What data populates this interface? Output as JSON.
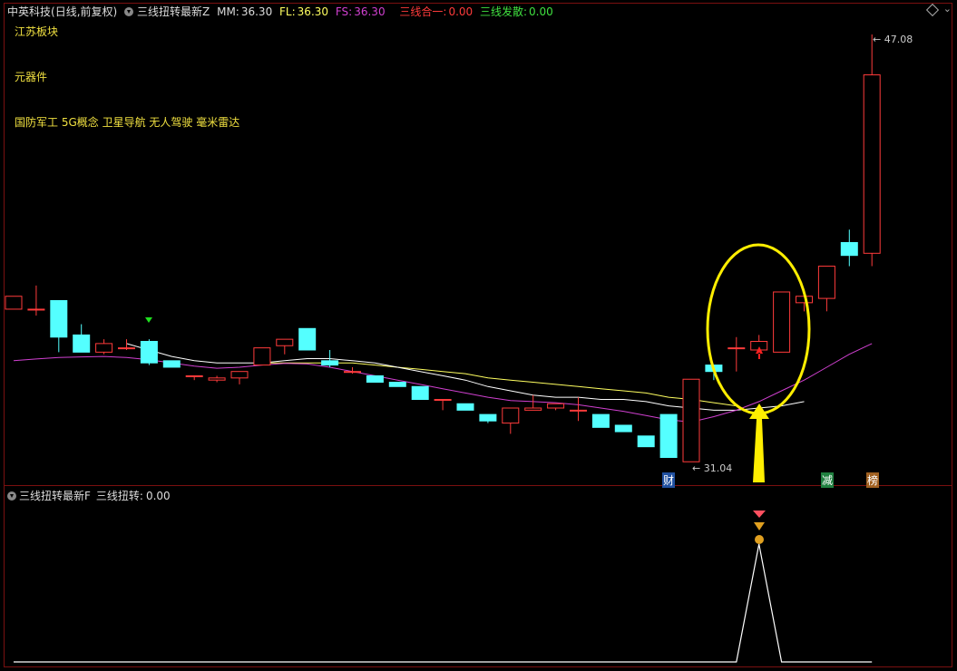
{
  "header": {
    "stock_name": "中英科技",
    "mode": "(日线,前复权)",
    "indicator": "三线扭转最新Z",
    "mm_label": "MM:",
    "mm_value": "36.30",
    "fl_label": "FL:",
    "fl_value": "36.30",
    "fs_label": "FS:",
    "fs_value": "36.30",
    "hy_label": "三线合一:",
    "hy_value": "0.00",
    "fs2_label": "三线发散:",
    "fs2_value": "0.00"
  },
  "labels": {
    "block1": "江苏板块",
    "block2": "元器件",
    "block3": "国防军工 5G概念 卫星导航 无人驾驶 毫米雷达"
  },
  "price_tags": {
    "high": "47.08",
    "low": "31.04"
  },
  "markers": {
    "cai": "财",
    "jian": "减",
    "bang": "榜"
  },
  "sub": {
    "indicator": "三线扭转最新F",
    "label": "三线扭转:",
    "value": "0.00"
  },
  "colors": {
    "up": "#ff3b3b",
    "down": "#54ffff",
    "ma1": "#ffff60",
    "ma2": "#ffffff",
    "ma3": "#d040d0",
    "highlight": "#ffee00"
  },
  "chart_data": {
    "type": "candlestick",
    "ohlc": [
      [
        34.3,
        34.9,
        34.3,
        34.9
      ],
      [
        34.3,
        34.3,
        35.4,
        34.0
      ],
      [
        34.7,
        33.0,
        34.7,
        32.3
      ],
      [
        33.1,
        32.3,
        33.6,
        32.3
      ],
      [
        32.3,
        32.7,
        32.9,
        32.2
      ],
      [
        32.5,
        32.5,
        32.9,
        32.4
      ],
      [
        32.8,
        31.8,
        32.9,
        31.7
      ],
      [
        31.9,
        31.6,
        31.9,
        31.6
      ],
      [
        31.2,
        31.2,
        31.2,
        31.0
      ],
      [
        31.0,
        31.1,
        31.2,
        30.9
      ],
      [
        31.1,
        31.4,
        31.4,
        30.8
      ],
      [
        31.7,
        32.5,
        32.5,
        31.7
      ],
      [
        32.6,
        32.9,
        32.9,
        32.2
      ],
      [
        33.4,
        32.4,
        33.4,
        32.4
      ],
      [
        31.9,
        31.7,
        32.4,
        31.6
      ],
      [
        31.4,
        31.4,
        31.6,
        31.3
      ],
      [
        31.2,
        30.9,
        31.2,
        30.9
      ],
      [
        30.9,
        30.7,
        30.9,
        30.7
      ],
      [
        30.7,
        30.1,
        30.7,
        30.1
      ],
      [
        30.1,
        30.1,
        30.1,
        29.6
      ],
      [
        29.9,
        29.6,
        29.9,
        29.6
      ],
      [
        29.4,
        29.1,
        29.4,
        29.0
      ],
      [
        29.0,
        29.7,
        29.7,
        28.5
      ],
      [
        29.6,
        29.7,
        30.3,
        29.6
      ],
      [
        29.7,
        29.9,
        29.9,
        29.6
      ],
      [
        29.6,
        29.6,
        30.2,
        29.1
      ],
      [
        29.4,
        28.8,
        29.4,
        28.8
      ],
      [
        28.9,
        28.6,
        28.9,
        28.6
      ],
      [
        28.4,
        27.9,
        28.4,
        27.9
      ],
      [
        29.4,
        27.4,
        29.4,
        27.4
      ],
      [
        27.2,
        31.04,
        31.04,
        27.2
      ],
      [
        31.7,
        31.4,
        31.7,
        31.0
      ],
      [
        32.5,
        32.5,
        33.0,
        31.4
      ],
      [
        32.4,
        32.8,
        33.1,
        32.3
      ],
      [
        32.3,
        35.1,
        35.1,
        32.3
      ],
      [
        34.6,
        34.9,
        34.9,
        34.2
      ],
      [
        34.8,
        36.3,
        36.3,
        34.2
      ],
      [
        37.4,
        36.8,
        38.0,
        36.3
      ],
      [
        36.9,
        45.2,
        47.08,
        36.3
      ]
    ],
    "ma_fast": [
      null,
      null,
      null,
      null,
      null,
      32.7,
      32.4,
      32.1,
      31.9,
      31.8,
      31.8,
      31.8,
      31.9,
      32.0,
      32.0,
      31.9,
      31.8,
      31.6,
      31.4,
      31.2,
      31.0,
      30.7,
      30.5,
      30.3,
      30.2,
      30.2,
      30.1,
      30.1,
      30.0,
      29.8,
      29.7,
      29.6,
      29.6,
      29.7,
      29.8,
      30.0,
      null,
      null,
      null
    ],
    "ma_slow": [
      null,
      null,
      null,
      null,
      null,
      null,
      null,
      null,
      null,
      null,
      null,
      31.8,
      31.8,
      31.8,
      31.8,
      31.8,
      31.7,
      31.6,
      31.5,
      31.4,
      31.3,
      31.1,
      31.0,
      30.9,
      30.8,
      30.7,
      30.6,
      30.5,
      30.4,
      30.2,
      30.1,
      29.95,
      29.8,
      null,
      null,
      null,
      null,
      null,
      null
    ],
    "ma_purple": [
      31.9,
      31.98,
      32.05,
      32.08,
      32.1,
      32.05,
      31.95,
      31.8,
      31.65,
      31.55,
      31.6,
      31.7,
      31.78,
      31.75,
      31.6,
      31.4,
      31.2,
      31.0,
      30.8,
      30.6,
      30.4,
      30.2,
      30.05,
      30.0,
      29.95,
      29.85,
      29.7,
      29.55,
      29.35,
      29.15,
      29.05,
      29.3,
      29.6,
      30.0,
      30.5,
      31.0,
      31.6,
      32.2,
      32.7
    ],
    "sub_values": [
      0,
      0,
      0,
      0,
      0,
      0,
      0,
      0,
      0,
      0,
      0,
      0,
      0,
      0,
      0,
      0,
      0,
      0,
      0,
      0,
      0,
      0,
      0,
      0,
      0,
      0,
      0,
      0,
      0,
      0,
      0,
      0,
      0,
      1,
      0,
      0,
      0,
      0,
      0
    ]
  }
}
